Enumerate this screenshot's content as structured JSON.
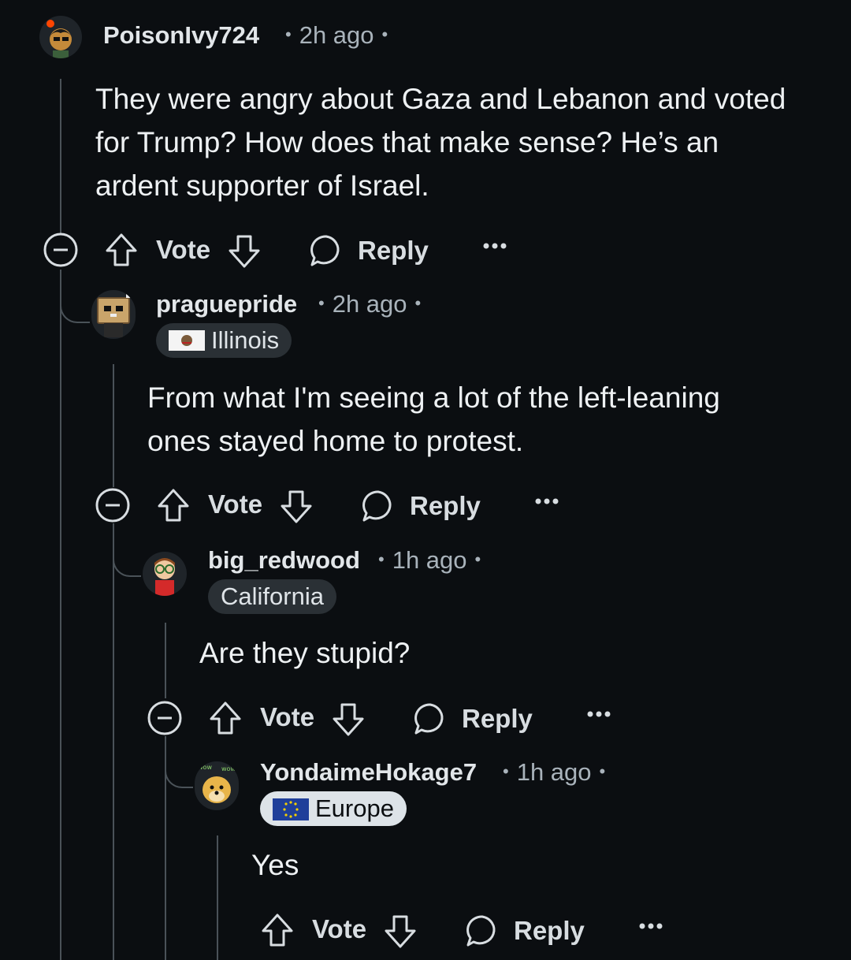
{
  "comments": [
    {
      "username": "PoisonIvy724",
      "time": "2h ago",
      "flair": "",
      "body_lines": [
        "They were angry about Gaza and Lebanon and voted",
        "for Trump? How does that make sense? He’s an",
        "ardent supporter of Israel."
      ],
      "vote_label": "Vote",
      "reply_label": "Reply"
    },
    {
      "username": "praguepride",
      "time": "2h ago",
      "flair": "Illinois",
      "body_lines": [
        "From what I'm seeing a lot of the left-leaning",
        "ones stayed home to protest."
      ],
      "vote_label": "Vote",
      "reply_label": "Reply"
    },
    {
      "username": "big_redwood",
      "time": "1h ago",
      "flair": "California",
      "body_lines": [
        "Are they stupid?"
      ],
      "vote_label": "Vote",
      "reply_label": "Reply"
    },
    {
      "username": "YondaimeHokage7",
      "time": "1h ago",
      "flair": "Europe",
      "body_lines": [
        "Yes"
      ],
      "vote_label": "Vote",
      "reply_label": "Reply"
    }
  ],
  "colors": {
    "background": "#0b0e11",
    "text": "#eef1f3",
    "meta": "#a9b3bb",
    "thread_line": "#4a5258"
  },
  "icons": [
    "collapse-icon",
    "upvote-icon",
    "downvote-icon",
    "reply-bubble-icon",
    "more-options-icon"
  ]
}
